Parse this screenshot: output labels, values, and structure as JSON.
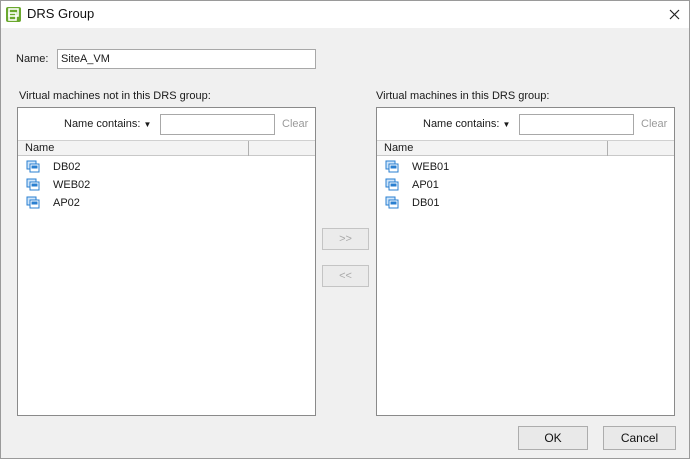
{
  "window": {
    "title": "DRS Group"
  },
  "name_field": {
    "label": "Name:",
    "value": "SiteA_VM"
  },
  "left_panel": {
    "label": "Virtual machines not in this DRS group:",
    "filter_label": "Name contains:",
    "filter_value": "",
    "clear_label": "Clear",
    "column_header": "Name",
    "items": [
      "DB02",
      "WEB02",
      "AP02"
    ]
  },
  "right_panel": {
    "label": "Virtual machines in this DRS group:",
    "filter_label": "Name contains:",
    "filter_value": "",
    "clear_label": "Clear",
    "column_header": "Name",
    "items": [
      "WEB01",
      "AP01",
      "DB01"
    ]
  },
  "buttons": {
    "add": ">>",
    "remove": "<<",
    "ok": "OK",
    "cancel": "Cancel"
  },
  "icons": {
    "app": "vsphere-logo-icon",
    "vm": "virtual-machine-icon",
    "dropdown": "dropdown-triangle-icon",
    "close": "close-icon"
  },
  "colors": {
    "logo_green": "#6aa82e",
    "vm_blue": "#2a7fd0",
    "disabled_text": "#a9a9a9"
  }
}
